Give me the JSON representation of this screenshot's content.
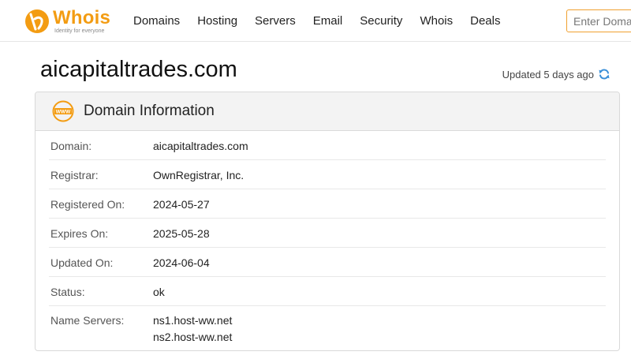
{
  "brand": {
    "name": "Whois",
    "tagline": "Identity for everyone",
    "accent": "#f39c12"
  },
  "nav": {
    "items": [
      {
        "label": "Domains"
      },
      {
        "label": "Hosting"
      },
      {
        "label": "Servers"
      },
      {
        "label": "Email"
      },
      {
        "label": "Security"
      },
      {
        "label": "Whois"
      },
      {
        "label": "Deals"
      }
    ]
  },
  "search": {
    "placeholder": "Enter Domain"
  },
  "page": {
    "title": "aicapitaltrades.com",
    "updated": "Updated 5 days ago",
    "refresh_icon": "refresh-icon"
  },
  "card": {
    "title": "Domain Information",
    "icon": "www-icon",
    "rows": [
      {
        "label": "Domain:",
        "value": "aicapitaltrades.com"
      },
      {
        "label": "Registrar:",
        "value": "OwnRegistrar, Inc."
      },
      {
        "label": "Registered On:",
        "value": "2024-05-27"
      },
      {
        "label": "Expires On:",
        "value": "2025-05-28"
      },
      {
        "label": "Updated On:",
        "value": "2024-06-04"
      },
      {
        "label": "Status:",
        "value": "ok"
      }
    ],
    "name_servers": {
      "label": "Name Servers:",
      "values": [
        "ns1.host-ww.net",
        "ns2.host-ww.net"
      ]
    }
  }
}
